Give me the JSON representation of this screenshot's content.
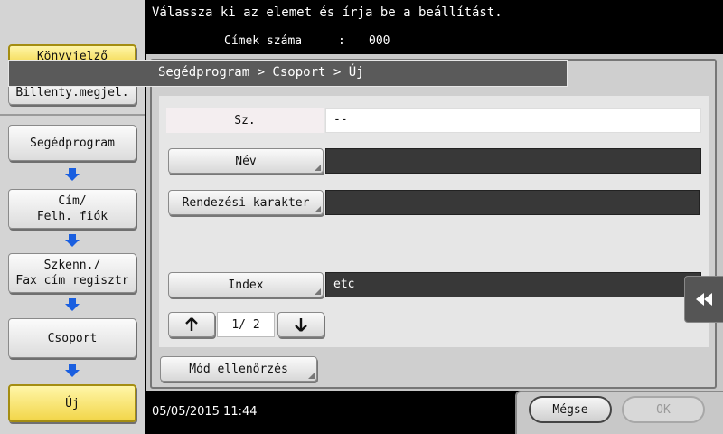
{
  "header": {
    "message": "Válassza ki az elemet és írja be a beállítást.",
    "count_label": "Címek száma",
    "count_sep": ":",
    "count_value": "000"
  },
  "sidebar": {
    "bookmark": "Könyvjelző",
    "keyboard": "Billenty.megjel.",
    "path": [
      {
        "label": "Segédprogram"
      },
      {
        "label": "Cím/\nFelh. fiók"
      },
      {
        "label": "Szkenn./\nFax cím regisztr"
      },
      {
        "label": "Csoport"
      },
      {
        "label": "Új"
      }
    ]
  },
  "breadcrumb": "Segédprogram > Csoport > Új",
  "form": {
    "no_label": "Sz.",
    "no_value": "--",
    "name_label": "Név",
    "name_value": "",
    "sort_label": "Rendezési karakter",
    "sort_value": "",
    "index_label": "Index",
    "index_value": "etc"
  },
  "pager": {
    "text": "1/ 2"
  },
  "mode_check": "Mód ellenőrzés",
  "footer": {
    "datetime": "05/05/2015  11:44",
    "cancel": "Mégse",
    "ok": "OK"
  },
  "colors": {
    "accent_yellow": "#f2d64a",
    "nav_arrow": "#1a5fe0",
    "dark_field": "#383838"
  },
  "icons": {
    "flow_arrow": "arrow-down-icon",
    "page_up": "arrow-up-icon",
    "page_down": "arrow-down-icon",
    "collapse": "double-left-icon"
  }
}
